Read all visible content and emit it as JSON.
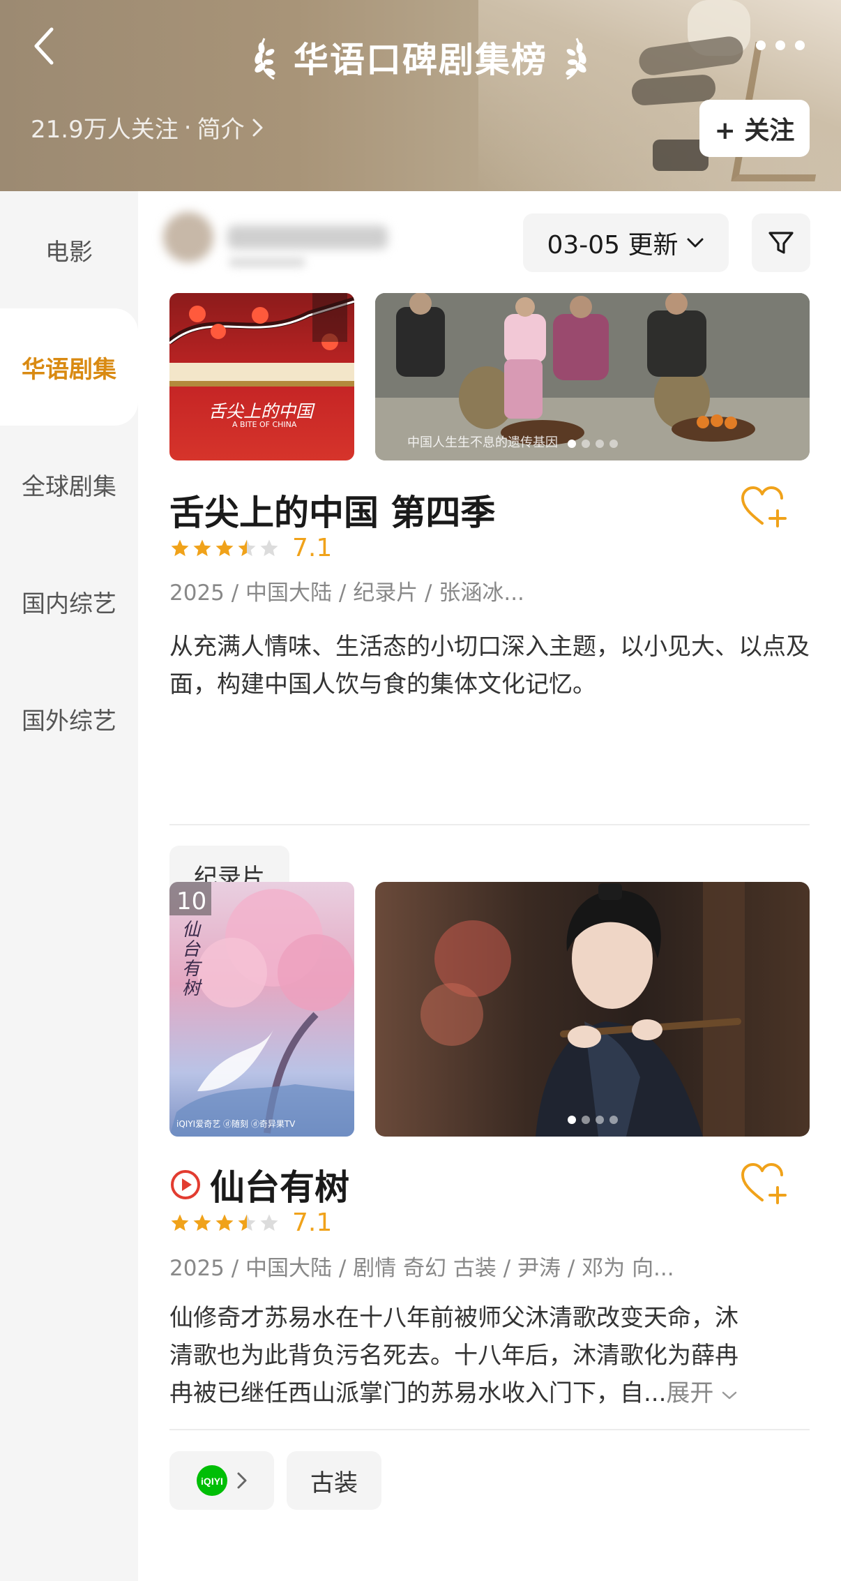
{
  "header": {
    "title": "华语口碑剧集榜",
    "followers": "21.9万人关注",
    "separator": "·",
    "intro_label": "简介",
    "follow_label": "+ 关注"
  },
  "sidebar": {
    "items": [
      {
        "label": "电影",
        "active": false
      },
      {
        "label": "华语剧集",
        "active": true
      },
      {
        "label": "全球剧集",
        "active": false
      },
      {
        "label": "国内综艺",
        "active": false
      },
      {
        "label": "国外综艺",
        "active": false
      }
    ]
  },
  "toolbar": {
    "date_label": "03-05 更新"
  },
  "shows": [
    {
      "title": "舌尖上的中国 第四季",
      "rating_value": 7.1,
      "score": "7.1",
      "meta": "2025 / 中国大陆 / 纪录片 / 张涵冰...",
      "description": "从充满人情味、生活态的小切口深入主题，以小见大、以点及面，构建中国人饮与食的集体文化记忆。",
      "poster_text": "舌尖上的中国",
      "poster_subtext": "A BITE OF CHINA",
      "still_caption": "中国人生生不息的遗传基因",
      "tags": [
        "纪录片"
      ]
    },
    {
      "title": "仙台有树",
      "rating_value": 7.1,
      "score": "7.1",
      "meta": "2025 / 中国大陆 / 剧情 奇幻 古装 / 尹涛 / 邓为 向...",
      "description_line1": "仙修奇才苏易水在十八年前被师父沐清歌改变天命，沐",
      "description_line2": "清歌也为此背负污名死去。十八年后，沐清歌化为薛冉",
      "description_line3": "冉被已继任西山派掌门的苏易水收入门下，自...",
      "expand_label": "展开",
      "poster_rank": "10",
      "poster_text": "仙台有树",
      "poster_logos": "iQIYI爱奇艺 ⓓ随刻 ⓓ奇异果TV",
      "platform": "iQIYI",
      "tags": [
        "古装"
      ]
    }
  ],
  "colors": {
    "accent": "#d98a12",
    "star": "#f0a21a",
    "play": "#e23c30",
    "iqiyi": "#00be06"
  }
}
